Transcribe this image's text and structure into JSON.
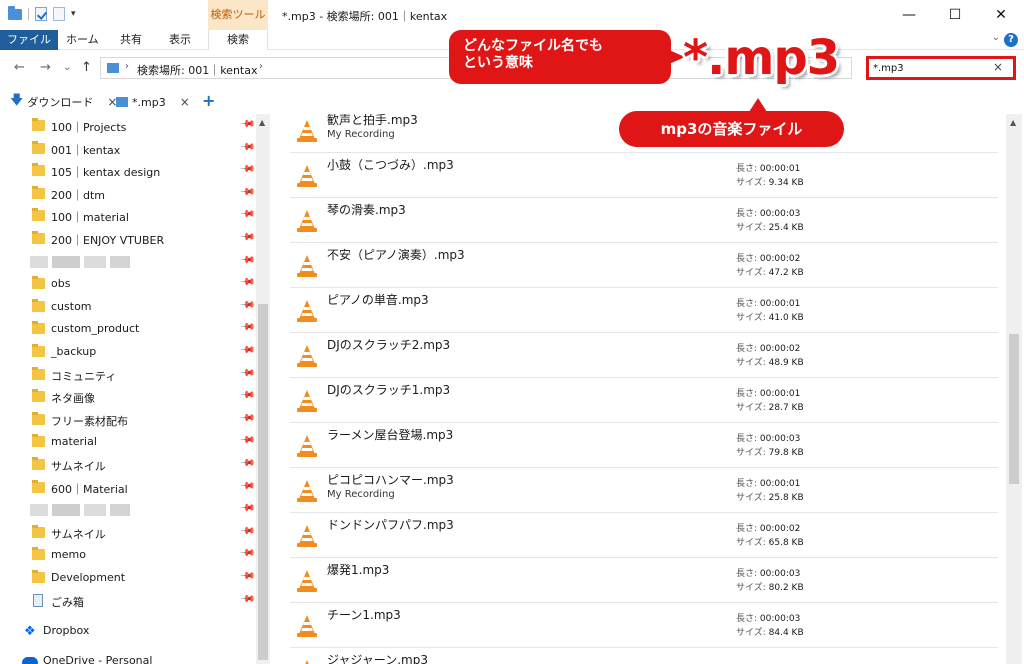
{
  "titlebar": {
    "search_tools_label": "検索ツール",
    "window_title": "*.mp3 - 検索場所: 001｜kentax",
    "minimize": "—",
    "maximize": "☐",
    "close": "✕"
  },
  "ribbon": {
    "tabs": [
      "ファイル",
      "ホーム",
      "共有",
      "表示",
      "検索"
    ]
  },
  "address": {
    "back": "←",
    "forward": "→",
    "recent": "⌄",
    "up": "↑",
    "breadcrumb": [
      "検索場所: 001｜kentax"
    ],
    "search_value": "*.mp3",
    "search_clear": "×"
  },
  "tabs": [
    {
      "label": "ダウンロード",
      "close": "×"
    },
    {
      "label": "*.mp3",
      "close": "×"
    }
  ],
  "add_tab": "+",
  "sidebar": {
    "items": [
      {
        "label": "100｜Projects",
        "type": "folder"
      },
      {
        "label": "001｜kentax",
        "type": "folder"
      },
      {
        "label": "105｜kentax design",
        "type": "folder"
      },
      {
        "label": "200｜dtm",
        "type": "folder"
      },
      {
        "label": "100｜material",
        "type": "folder"
      },
      {
        "label": "200｜ENJOY VTUBER",
        "type": "folder"
      },
      {
        "label": "",
        "type": "blurred"
      },
      {
        "label": "obs",
        "type": "folder"
      },
      {
        "label": "custom",
        "type": "folder"
      },
      {
        "label": "custom_product",
        "type": "folder"
      },
      {
        "label": "_backup",
        "type": "folder"
      },
      {
        "label": "コミュニティ",
        "type": "folder"
      },
      {
        "label": "ネタ画像",
        "type": "folder"
      },
      {
        "label": "フリー素材配布",
        "type": "folder"
      },
      {
        "label": "material",
        "type": "folder"
      },
      {
        "label": "サムネイル",
        "type": "folder"
      },
      {
        "label": "600｜Material",
        "type": "folder"
      },
      {
        "label": "",
        "type": "blurred"
      },
      {
        "label": "サムネイル",
        "type": "folder"
      },
      {
        "label": "memo",
        "type": "folder"
      },
      {
        "label": "Development",
        "type": "folder"
      },
      {
        "label": "ごみ箱",
        "type": "trash"
      }
    ],
    "dropbox": "Dropbox",
    "onedrive": "OneDrive - Personal"
  },
  "files": {
    "length_key": "長さ:",
    "size_key": "サイズ:",
    "rows": [
      {
        "name": "歓声と拍手.mp3",
        "sub": "My Recording",
        "length": "",
        "size": ""
      },
      {
        "name": "小鼓（こつづみ）.mp3",
        "sub": "",
        "length": "00:00:01",
        "size": "9.34 KB"
      },
      {
        "name": "琴の滑奏.mp3",
        "sub": "",
        "length": "00:00:03",
        "size": "25.4 KB"
      },
      {
        "name": "不安（ピアノ演奏）.mp3",
        "sub": "",
        "length": "00:00:02",
        "size": "47.2 KB"
      },
      {
        "name": "ピアノの単音.mp3",
        "sub": "",
        "length": "00:00:01",
        "size": "41.0 KB"
      },
      {
        "name": "DJのスクラッチ2.mp3",
        "sub": "",
        "length": "00:00:02",
        "size": "48.9 KB"
      },
      {
        "name": "DJのスクラッチ1.mp3",
        "sub": "",
        "length": "00:00:01",
        "size": "28.7 KB"
      },
      {
        "name": "ラーメン屋台登場.mp3",
        "sub": "",
        "length": "00:00:03",
        "size": "79.8 KB"
      },
      {
        "name": "ピコピコハンマー.mp3",
        "sub": "My Recording",
        "length": "00:00:01",
        "size": "25.8 KB"
      },
      {
        "name": "ドンドンパフパフ.mp3",
        "sub": "",
        "length": "00:00:02",
        "size": "65.8 KB"
      },
      {
        "name": "爆発1.mp3",
        "sub": "",
        "length": "00:00:03",
        "size": "80.2 KB"
      },
      {
        "name": "チーン1.mp3",
        "sub": "",
        "length": "00:00:03",
        "size": "84.4 KB"
      },
      {
        "name": "ジャジャーン.mp3",
        "sub": "",
        "length": "",
        "size": ""
      }
    ]
  },
  "annotations": {
    "any_filename_line1": "どんなファイル名でも",
    "any_filename_line2": "という意味",
    "pattern": "*.mp3",
    "mp3_music": "mp3の音楽ファイル"
  },
  "colors": {
    "accent_red": "#e01515",
    "file_tab": "#1f5e9a",
    "search_tools": "#fbe6c8",
    "folder": "#f4c542",
    "vlc_orange": "#f28c1e"
  }
}
